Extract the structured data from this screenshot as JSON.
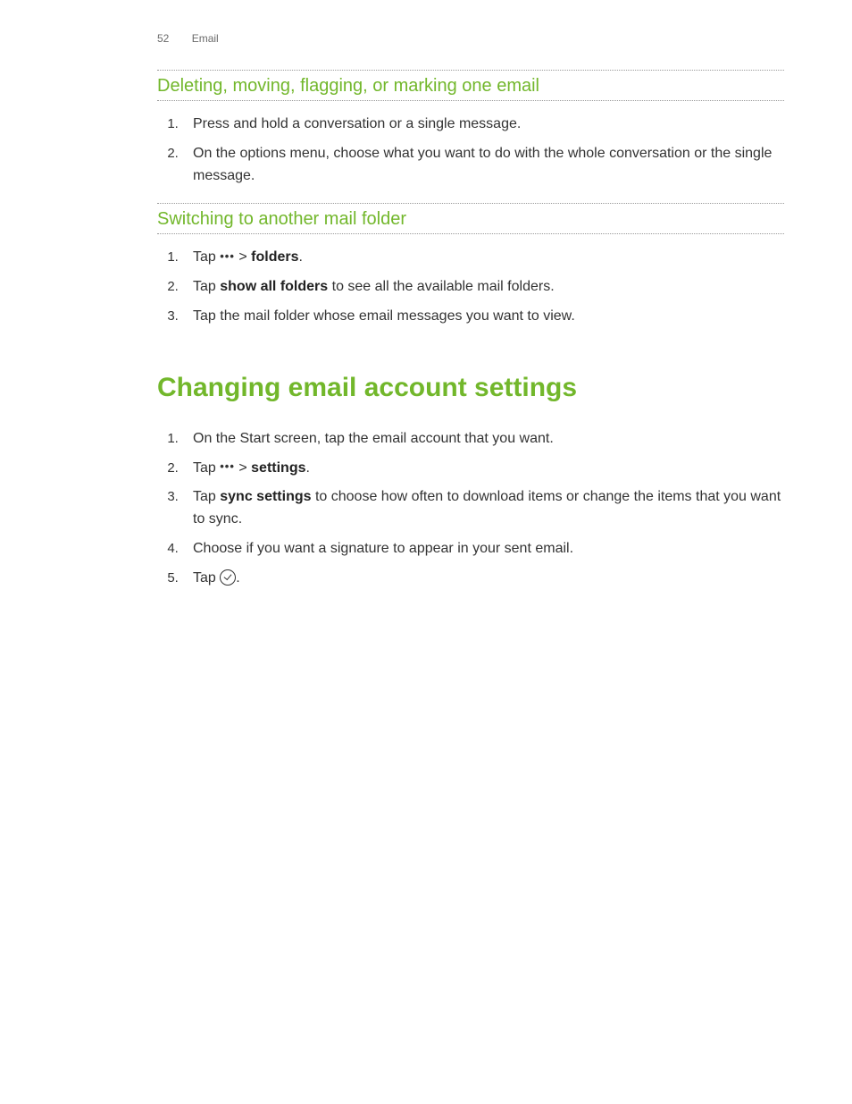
{
  "header": {
    "page_number": "52",
    "chapter": "Email"
  },
  "section1": {
    "title": "Deleting, moving, flagging, or marking one email",
    "steps": [
      "Press and hold a conversation or a single message.",
      "On the options menu, choose what you want to do with the whole conversation or the single message."
    ]
  },
  "section2": {
    "title": "Switching to another mail folder",
    "steps": {
      "s1_pre": "Tap ",
      "s1_gt": " > ",
      "s1_bold": "folders",
      "s1_post": ".",
      "s2_pre": "Tap ",
      "s2_bold": "show all folders",
      "s2_post": " to see all the available mail folders.",
      "s3": "Tap the mail folder whose email messages you want to view."
    }
  },
  "section3": {
    "title": "Changing email account settings",
    "steps": {
      "s1": "On the Start screen, tap the email account that you want.",
      "s2_pre": "Tap ",
      "s2_gt": " > ",
      "s2_bold": "settings",
      "s2_post": ".",
      "s3_pre": "Tap ",
      "s3_bold": "sync settings",
      "s3_post": " to choose how often to download items or change the items that you want to sync.",
      "s4": "Choose if you want a signature to appear in your sent email.",
      "s5_pre": "Tap ",
      "s5_post": "."
    }
  },
  "icons": {
    "more": "•••"
  }
}
